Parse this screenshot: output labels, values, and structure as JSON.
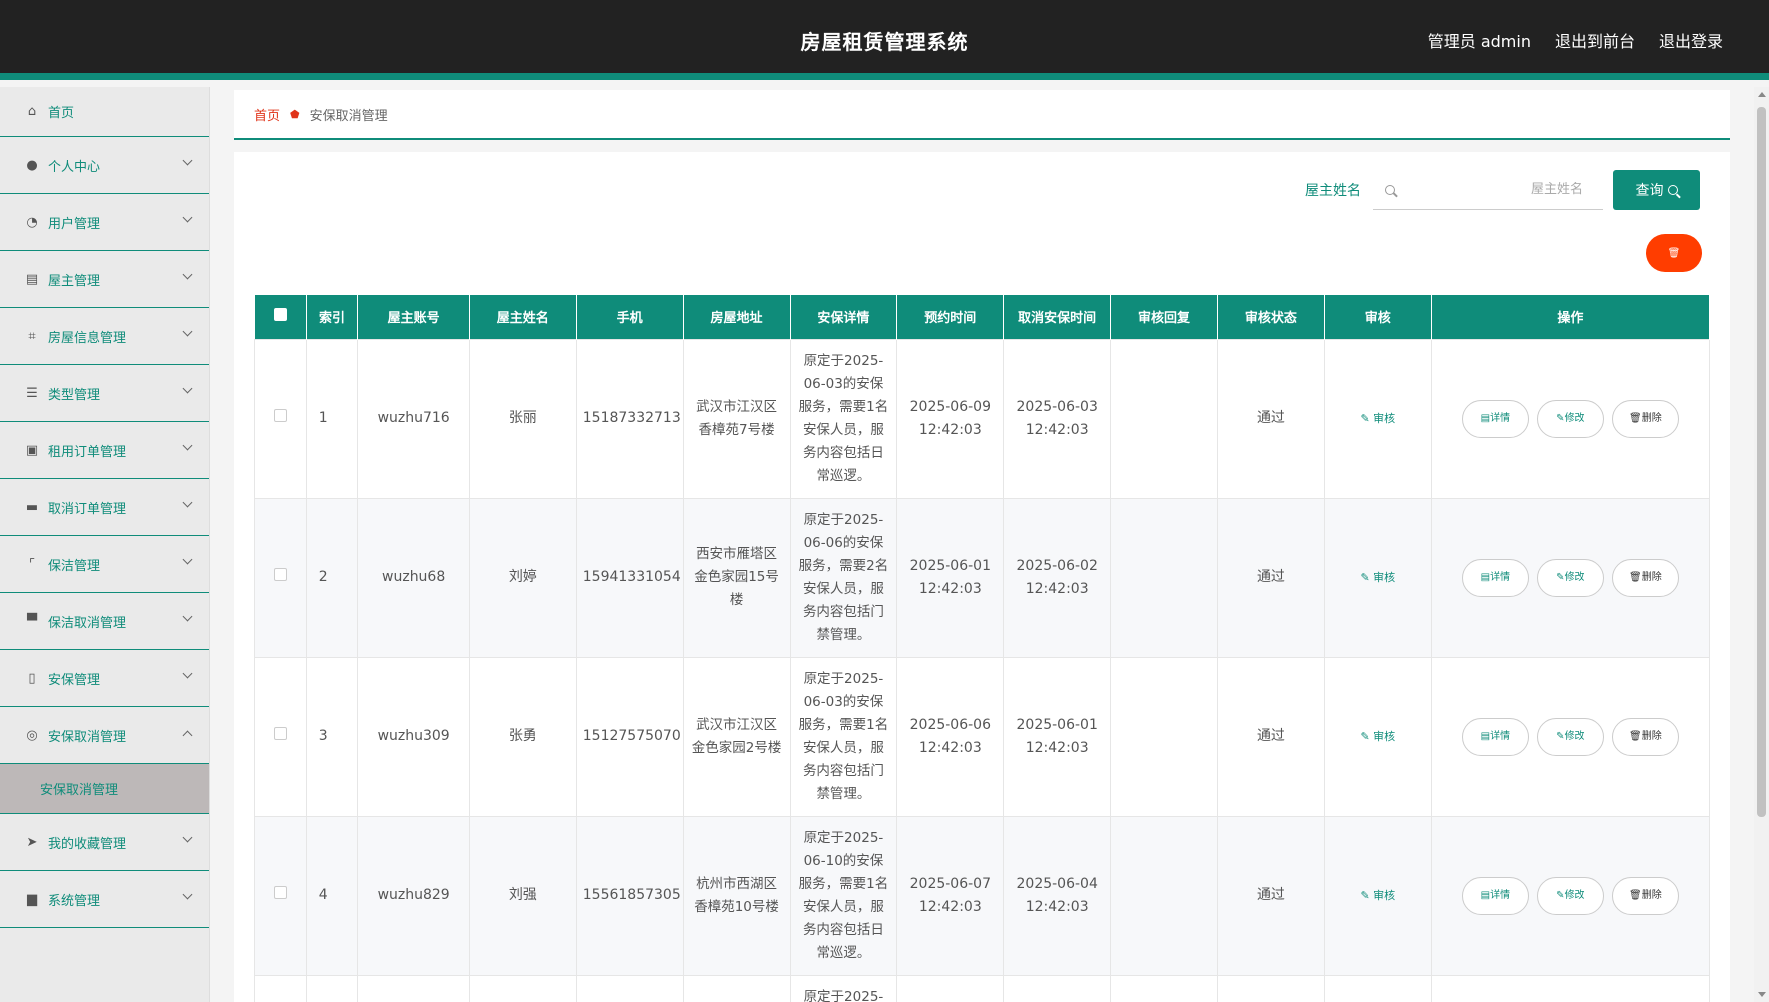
{
  "header": {
    "title": "房屋租赁管理系统",
    "admin": "管理员 admin",
    "to_front": "退出到前台",
    "logout": "退出登录"
  },
  "sidebar": {
    "items": [
      {
        "label": "首页",
        "icon": "home-icon"
      },
      {
        "label": "个人中心",
        "icon": "user-icon"
      },
      {
        "label": "用户管理",
        "icon": "gauge-icon"
      },
      {
        "label": "屋主管理",
        "icon": "clipboard-icon"
      },
      {
        "label": "房屋信息管理",
        "icon": "crop-icon"
      },
      {
        "label": "类型管理",
        "icon": "list-icon"
      },
      {
        "label": "租用订单管理",
        "icon": "checklist-icon"
      },
      {
        "label": "取消订单管理",
        "icon": "flag-icon"
      },
      {
        "label": "保洁管理",
        "icon": "frame-icon"
      },
      {
        "label": "保洁取消管理",
        "icon": "briefcase-icon"
      },
      {
        "label": "安保管理",
        "icon": "phone-icon"
      },
      {
        "label": "安保取消管理",
        "icon": "circle-icon"
      },
      {
        "label": "我的收藏管理",
        "icon": "send-icon"
      },
      {
        "label": "系统管理",
        "icon": "archive-icon"
      }
    ],
    "sub_active": "安保取消管理"
  },
  "breadcrumb": {
    "home": "首页",
    "current": "安保取消管理"
  },
  "search": {
    "label": "屋主姓名",
    "placeholder": "屋主姓名",
    "button": "查询"
  },
  "delete_batch_icon": "trash-icon",
  "table": {
    "headers": [
      "",
      "索引",
      "屋主账号",
      "屋主姓名",
      "手机",
      "房屋地址",
      "安保详情",
      "预约时间",
      "取消安保时间",
      "审核回复",
      "审核状态",
      "审核",
      "操作"
    ],
    "review_label": "审核",
    "btn_detail": "详情",
    "btn_edit": "修改",
    "btn_delete": "删除",
    "rows": [
      {
        "index": "1",
        "account": "wuzhu716",
        "name": "张丽",
        "phone": "15187332713",
        "address": "武汉市江汉区香樟苑7号楼",
        "detail": "原定于2025-06-03的安保服务，需要1名安保人员，服务内容包括日常巡逻。",
        "appoint": "2025-06-09 12:42:03",
        "cancel": "2025-06-03 12:42:03",
        "reply": "",
        "status": "通过"
      },
      {
        "index": "2",
        "account": "wuzhu68",
        "name": "刘婷",
        "phone": "15941331054",
        "address": "西安市雁塔区金色家园15号楼",
        "detail": "原定于2025-06-06的安保服务，需要2名安保人员，服务内容包括门禁管理。",
        "appoint": "2025-06-01 12:42:03",
        "cancel": "2025-06-02 12:42:03",
        "reply": "",
        "status": "通过"
      },
      {
        "index": "3",
        "account": "wuzhu309",
        "name": "张勇",
        "phone": "15127575070",
        "address": "武汉市江汉区金色家园2号楼",
        "detail": "原定于2025-06-03的安保服务，需要1名安保人员，服务内容包括门禁管理。",
        "appoint": "2025-06-06 12:42:03",
        "cancel": "2025-06-01 12:42:03",
        "reply": "",
        "status": "通过"
      },
      {
        "index": "4",
        "account": "wuzhu829",
        "name": "刘强",
        "phone": "15561857305",
        "address": "杭州市西湖区香樟苑10号楼",
        "detail": "原定于2025-06-10的安保服务，需要1名安保人员，服务内容包括日常巡逻。",
        "appoint": "2025-06-07 12:42:03",
        "cancel": "2025-06-04 12:42:03",
        "reply": "",
        "status": "通过"
      }
    ],
    "partial_detail": "原定于2025-"
  },
  "colors": {
    "accent": "#0f8c7a",
    "header_bg": "#222222",
    "danger": "#ff3d00"
  }
}
